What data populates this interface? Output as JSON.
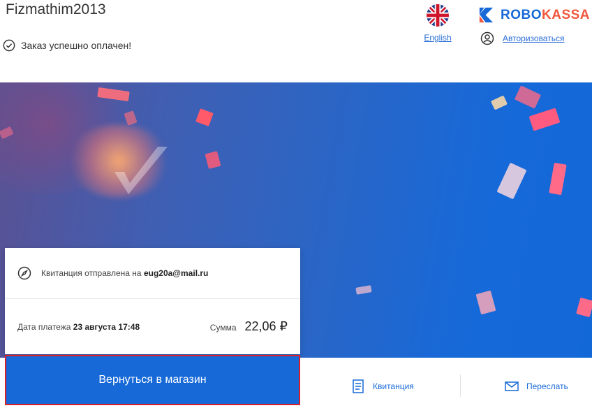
{
  "header": {
    "shop_name": "Fizmathim2013",
    "status_text": "Заказ успешно оплачен!",
    "language_label": "English",
    "auth_label": "Авторизоваться",
    "logo": {
      "part1": "ROBO",
      "part2": "KASSA"
    }
  },
  "receipt": {
    "sent_prefix": "Квитанция отправлена на",
    "email": "eug20a@mail.ru",
    "date_label": "Дата платежа",
    "date_value": "23 августа 17:48",
    "sum_label": "Сумма",
    "sum_value": "22,06 ₽"
  },
  "actions": {
    "back_to_shop": "Вернуться в магазин",
    "receipt": "Квитанция",
    "forward": "Переслать"
  },
  "colors": {
    "brand_blue": "#1769d8",
    "brand_orange": "#f0573d",
    "focus_border": "#d6202a"
  }
}
